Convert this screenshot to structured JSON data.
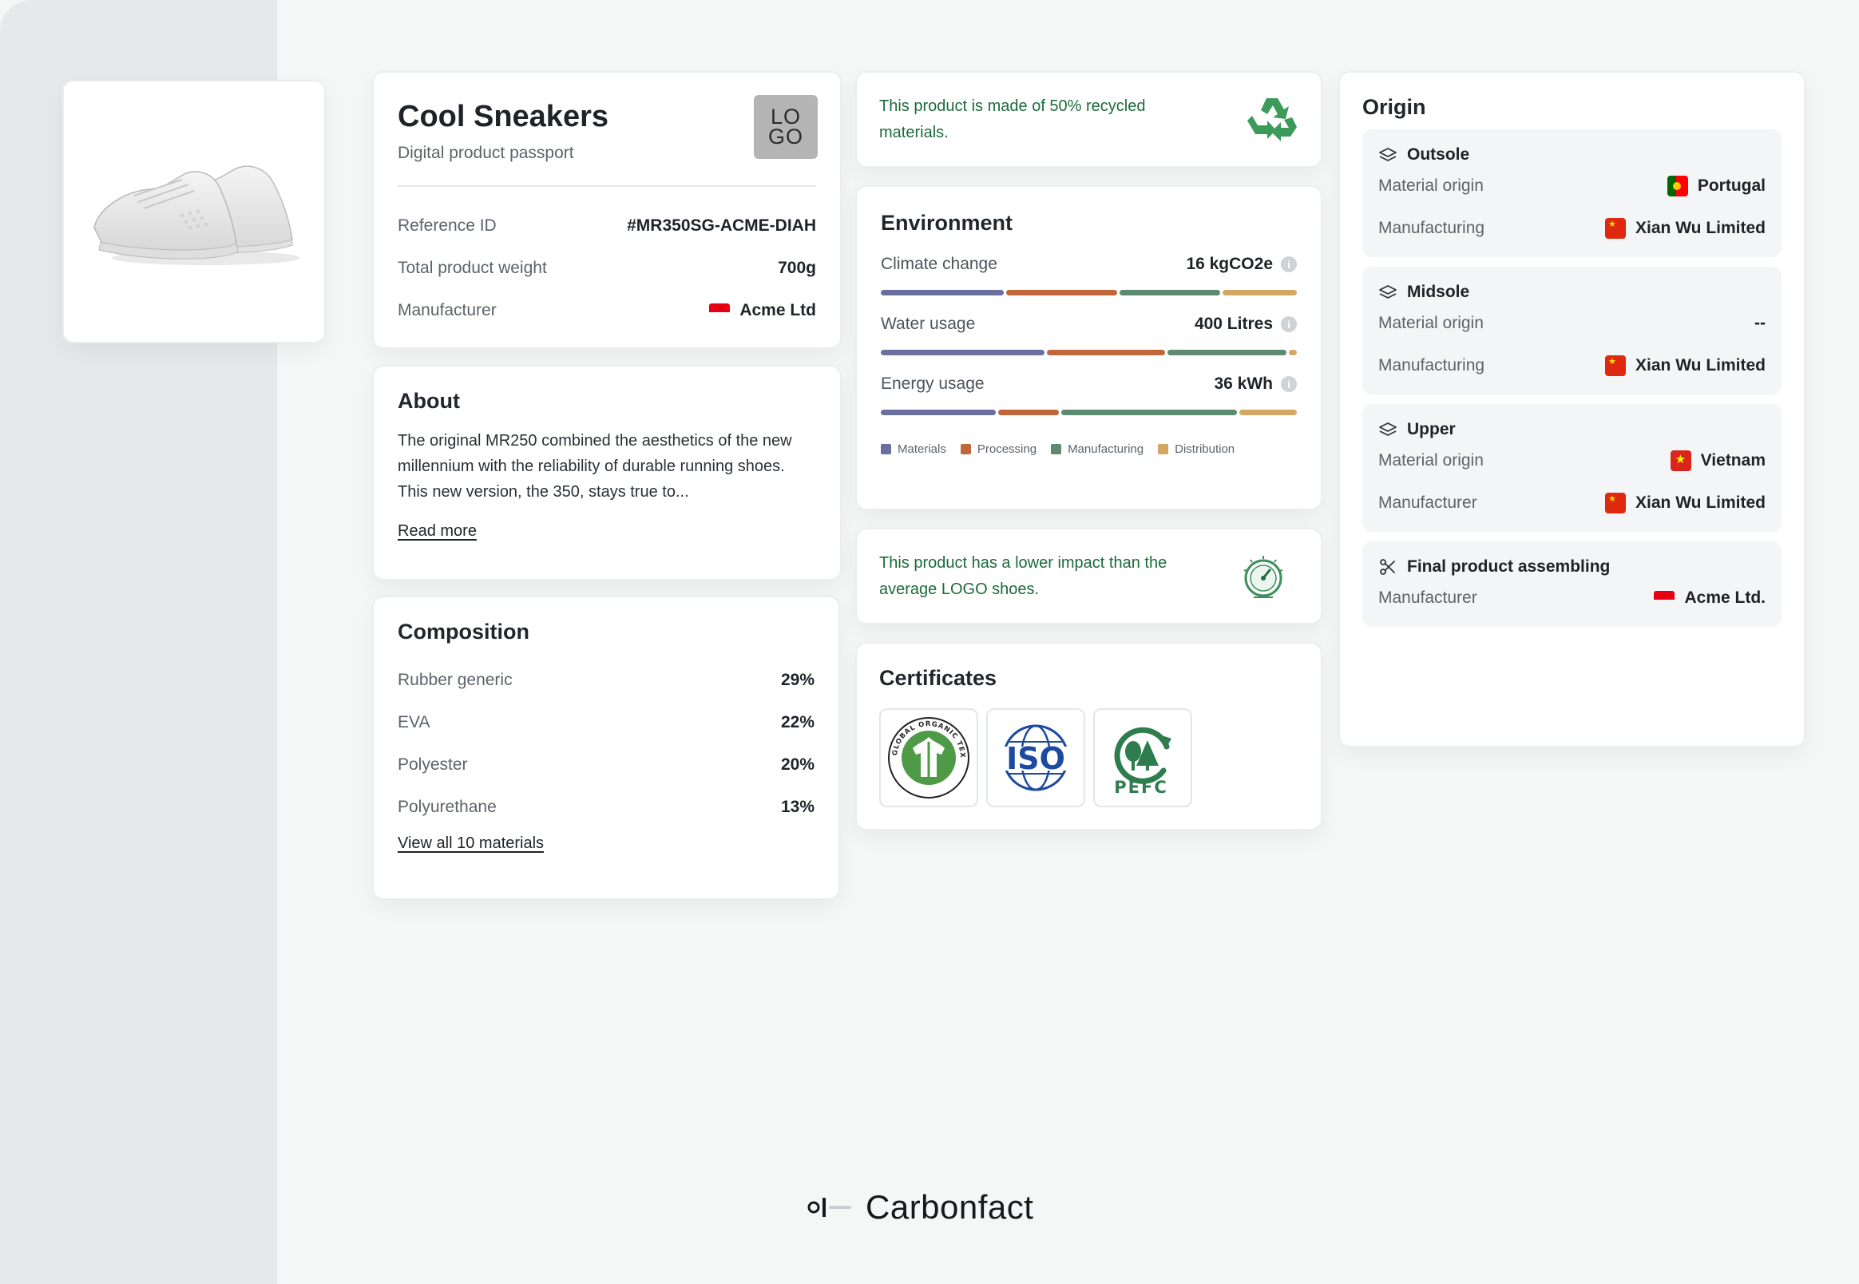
{
  "product": {
    "name": "Cool Sneakers",
    "subtitle": "Digital product passport",
    "logo_text_top": "LO",
    "logo_text_bottom": "GO",
    "rows": [
      {
        "label": "Reference ID",
        "value": "#MR350SG-ACME-DIAH"
      },
      {
        "label": "Total product weight",
        "value": "700g"
      },
      {
        "label": "Manufacturer",
        "value": "Acme Ltd"
      }
    ]
  },
  "about": {
    "title": "About",
    "text": "The original MR250 combined the aesthetics of the new millennium with the reliability of durable running shoes. This new version, the 350, stays true to...",
    "link": "Read more"
  },
  "composition": {
    "title": "Composition",
    "items": [
      {
        "label": "Rubber generic",
        "value": "29%"
      },
      {
        "label": "EVA",
        "value": "22%"
      },
      {
        "label": "Polyester",
        "value": "20%"
      },
      {
        "label": "Polyurethane",
        "value": "13%"
      }
    ],
    "link": "View all 10 materials"
  },
  "recycled": {
    "text": "This product is made of 50% recycled materials.",
    "icon": "recycle-icon"
  },
  "environment": {
    "title": "Environment",
    "metrics": [
      {
        "label": "Climate change",
        "value": "16 kgCO2e",
        "shares": [
          0.33,
          0.3,
          0.27,
          0.2
        ]
      },
      {
        "label": "Water usage",
        "value": "400 Litres",
        "shares": [
          0.4,
          0.29,
          0.29,
          0.02
        ]
      },
      {
        "label": "Energy usage",
        "value": "36 kWh",
        "shares": [
          0.34,
          0.18,
          0.52,
          0.17
        ]
      }
    ],
    "legend": [
      {
        "label": "Materials",
        "color": "#6b6f9e"
      },
      {
        "label": "Processing",
        "color": "#c0663a"
      },
      {
        "label": "Manufacturing",
        "color": "#5d8a70"
      },
      {
        "label": "Distribution",
        "color": "#d4a862"
      }
    ]
  },
  "impact": {
    "text": "This product has a lower impact than the average LOGO shoes.",
    "icon": "gauge-icon"
  },
  "certificates": {
    "title": "Certificates",
    "items": [
      {
        "name": "gots-logo",
        "text": "GLOBAL ORGANIC TEXTILE STANDARD · GOTS"
      },
      {
        "name": "iso-logo",
        "text": "ISO"
      },
      {
        "name": "pefc-logo",
        "text": "PEFC"
      }
    ]
  },
  "origin": {
    "title": "Origin",
    "blocks": [
      {
        "title": "Outsole",
        "icon": "layers-icon",
        "rows": [
          {
            "label": "Material origin",
            "value": "Portugal",
            "flag": "portugal"
          },
          {
            "label": "Manufacturing",
            "value": "Xian Wu Limited",
            "flag": "china"
          }
        ]
      },
      {
        "title": "Midsole",
        "icon": "layers-icon",
        "rows": [
          {
            "label": "Material origin",
            "value": "--",
            "flag": ""
          },
          {
            "label": "Manufacturing",
            "value": "Xian Wu Limited",
            "flag": "china"
          }
        ]
      },
      {
        "title": "Upper",
        "icon": "layers-icon",
        "rows": [
          {
            "label": "Material origin",
            "value": "Vietnam",
            "flag": "vietnam"
          },
          {
            "label": "Manufacturer",
            "value": "Xian Wu Limited",
            "flag": "china"
          }
        ]
      },
      {
        "title": "Final product assembling",
        "icon": "scissors-icon",
        "rows": [
          {
            "label": "Manufacturer",
            "value": "Acme Ltd.",
            "flag": "red"
          }
        ]
      }
    ]
  },
  "brand": {
    "name": "Carbonfact"
  }
}
